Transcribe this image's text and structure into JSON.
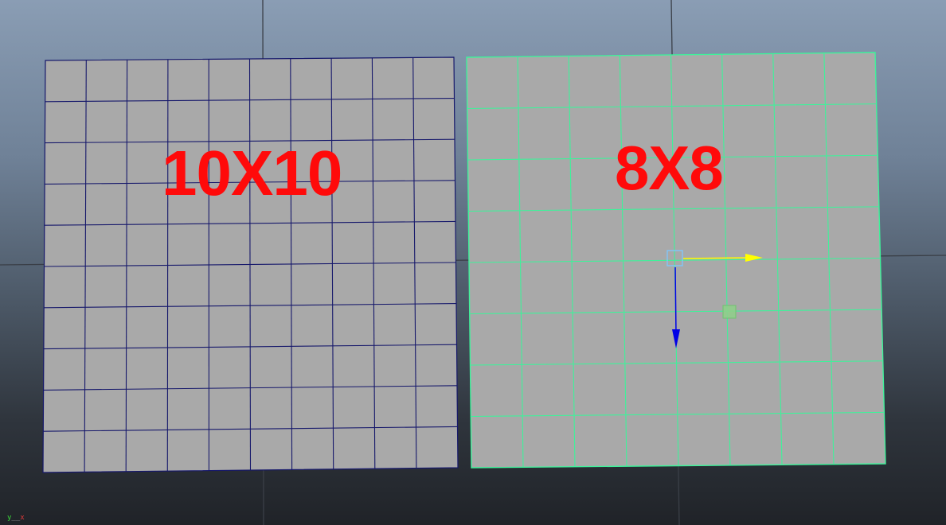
{
  "viewport": {
    "background_top": "#8a9db4",
    "background_bottom": "#202328"
  },
  "planes": [
    {
      "label": "10X10",
      "subdivisions": 10,
      "wire_color": "#16186b",
      "face_color": "#a9a9a9",
      "selected": false
    },
    {
      "label": "8X8",
      "subdivisions": 8,
      "wire_color": "#3ef29a",
      "face_color": "#a9a9a9",
      "selected": true
    }
  ],
  "label_color": "#ff0a0a",
  "move_manipulator": {
    "x_axis_color": "#ffff00",
    "z_axis_color": "#0000e6",
    "center_handle_color": "#7ec8ff",
    "plane_handle_color": "#76d376",
    "icon": "move-tool-icon"
  },
  "axis_indicator": {
    "y_label": "y",
    "x_label": "x",
    "y_color": "#3adb3a",
    "x_color": "#e23a3a"
  }
}
